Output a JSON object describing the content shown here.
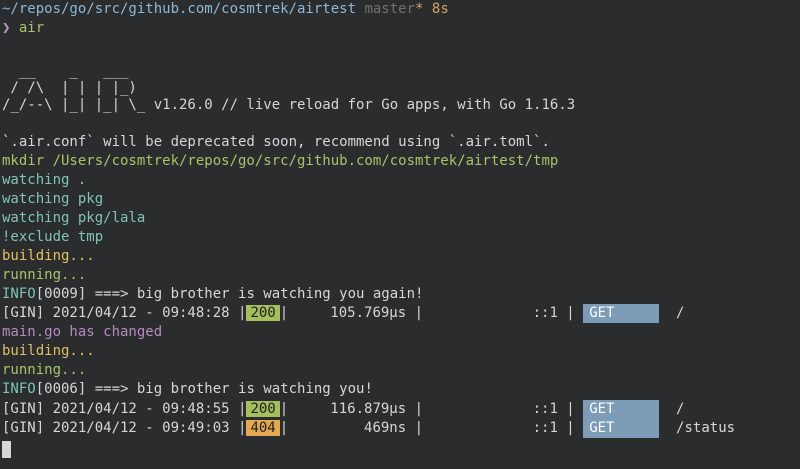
{
  "prompt": {
    "path": "~/repos/go/src/github.com/cosmtrek/airtest",
    "branch": "master",
    "dirty_marker": "*",
    "duration": "8s",
    "symbol": "❯",
    "command": "air"
  },
  "banner": {
    "line1": "  __    _   ___  ",
    "line2": " / /\\  | | | |_) ",
    "line3": "/_/--\\ |_| |_| \\_ ",
    "version": "v1.26.0 // live reload for Go apps, with Go 1.16.3"
  },
  "log": {
    "deprecation": "`.air.conf` will be deprecated soon, recommend using `.air.toml`.",
    "mkdir": "mkdir /Users/cosmtrek/repos/go/src/github.com/cosmtrek/airtest/tmp",
    "watch1": "watching .",
    "watch2": "watching pkg",
    "watch3": "watching pkg/lala",
    "exclude": "!exclude tmp",
    "building1": "building...",
    "running1": "running...",
    "info1_prefix": "INFO",
    "info1_code": "[0009]",
    "info1_msg": " ===> big brother is watching you again!",
    "changed": "main.go has changed",
    "building2": "building...",
    "running2": "running...",
    "info2_prefix": "INFO",
    "info2_code": "[0006]",
    "info2_msg": " ===> big brother is watching you!"
  },
  "requests": [
    {
      "prefix": "[GIN] 2021/04/12 - 09:48:28 |",
      "status": "200",
      "latency": "|     105.769µs |             ::1 |",
      "method": "GET",
      "path": "  /"
    },
    {
      "prefix": "[GIN] 2021/04/12 - 09:48:55 |",
      "status": "200",
      "latency": "|     116.879µs |             ::1 |",
      "method": "GET",
      "path": "  /"
    },
    {
      "prefix": "[GIN] 2021/04/12 - 09:49:03 |",
      "status": "404",
      "latency": "|         469ns |             ::1 |",
      "method": "GET",
      "path": "  /status"
    }
  ],
  "colors": {
    "background": "#2b2c2e",
    "status_ok": "#a4bf5b",
    "status_not_found": "#e2a854",
    "method_bg": "#7d9cb7"
  }
}
